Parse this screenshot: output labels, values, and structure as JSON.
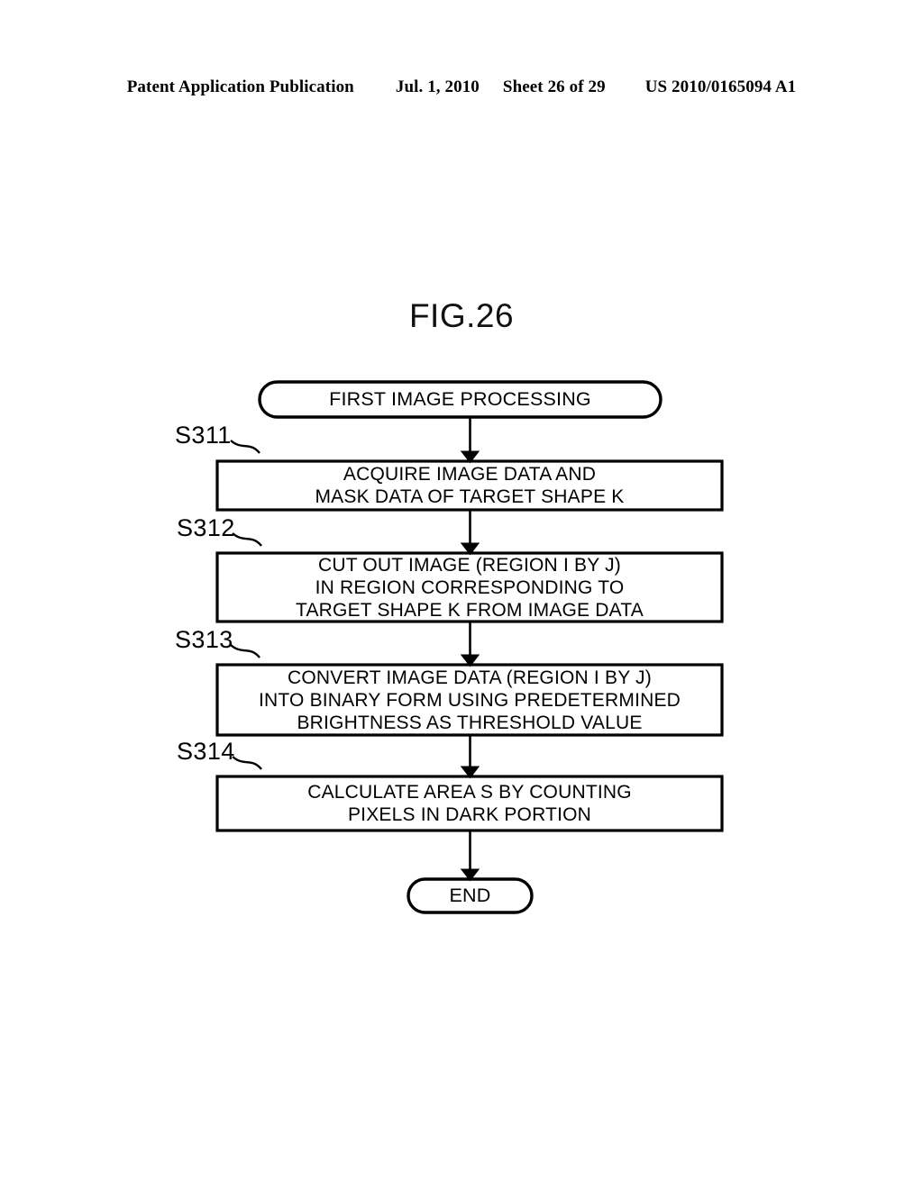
{
  "header": {
    "publication": "Patent Application Publication",
    "date": "Jul. 1, 2010",
    "sheet": "Sheet 26 of 29",
    "patent_number": "US 2010/0165094 A1"
  },
  "figure": {
    "title": "FIG.26",
    "type": "flowchart",
    "start_terminal": {
      "label": "FIRST IMAGE PROCESSING"
    },
    "end_terminal": {
      "label": "END"
    },
    "steps": [
      {
        "ref": "S311",
        "line1": "ACQUIRE IMAGE DATA AND",
        "line2": "MASK DATA OF TARGET SHAPE K",
        "line3": ""
      },
      {
        "ref": "S312",
        "line1": "CUT OUT IMAGE (REGION I BY J)",
        "line2": "IN REGION CORRESPONDING TO",
        "line3": "TARGET SHAPE K FROM IMAGE DATA"
      },
      {
        "ref": "S313",
        "line1": "CONVERT IMAGE DATA (REGION I BY J)",
        "line2": "INTO BINARY FORM USING PREDETERMINED",
        "line3": "BRIGHTNESS AS THRESHOLD VALUE"
      },
      {
        "ref": "S314",
        "line1": "CALCULATE AREA S BY COUNTING",
        "line2": "PIXELS IN DARK PORTION",
        "line3": ""
      }
    ]
  },
  "colors": {
    "ink": "#000000",
    "page_background": "#ffffff"
  }
}
